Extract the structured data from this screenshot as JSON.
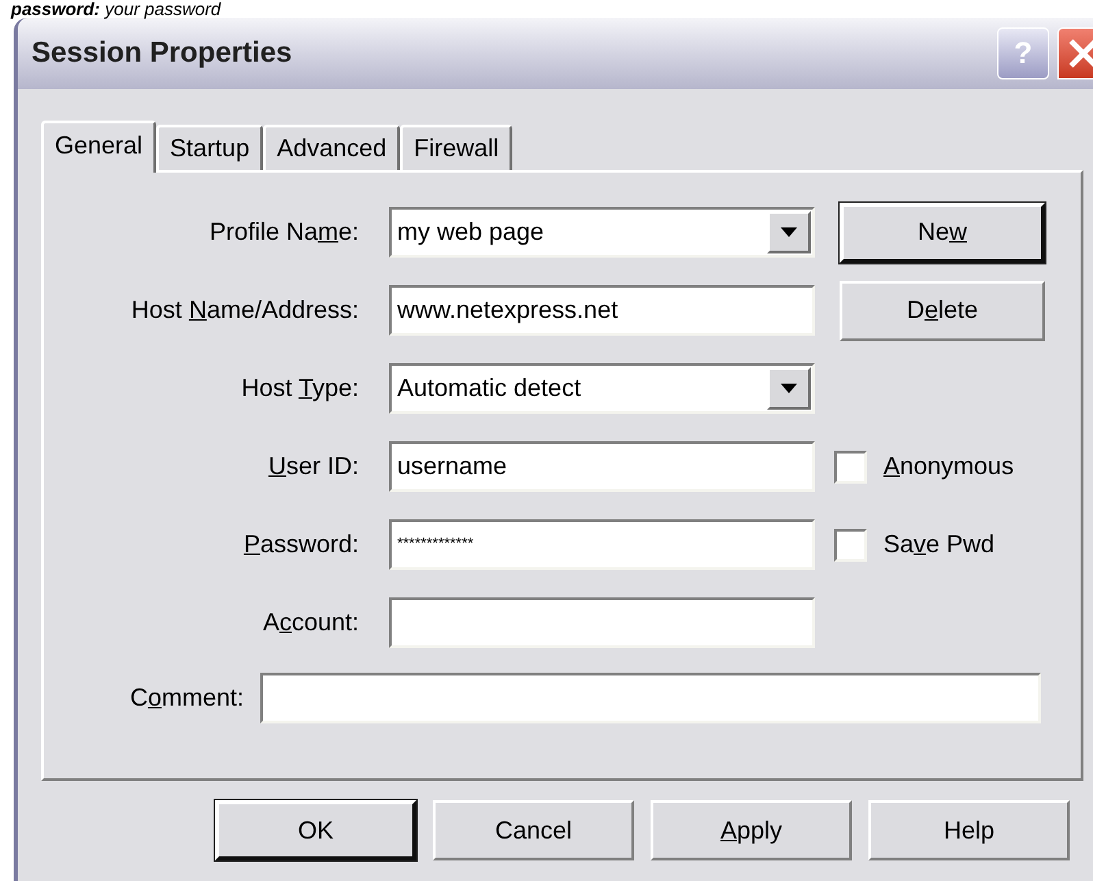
{
  "caption": "**password:** your password",
  "window": {
    "title": "Session Properties",
    "buttons": [
      {
        "kind": "help",
        "label": "?"
      },
      {
        "kind": "close"
      }
    ]
  },
  "tabs": [
    {
      "label": "General",
      "selected": true
    },
    {
      "label": "Startup",
      "selected": false
    },
    {
      "label": "Advanced",
      "selected": false
    },
    {
      "label": "Firewall",
      "selected": false
    }
  ],
  "fields": [
    {
      "kind": "combo",
      "label": {
        "pre": "Profile Na",
        "key": "m",
        "post": "e:"
      },
      "value": "my web page"
    },
    {
      "kind": "text",
      "label": {
        "pre": "Host ",
        "key": "N",
        "post": "ame/Address:"
      },
      "value": "www.netexpress.net"
    },
    {
      "kind": "combo",
      "label": {
        "pre": "Host ",
        "key": "T",
        "post": "ype:"
      },
      "value": "Automatic detect"
    },
    {
      "kind": "text",
      "label": {
        "key": "U",
        "post": "ser ID:"
      },
      "value": "username",
      "checkbox": {
        "label": {
          "key": "A",
          "post": "nonymous"
        },
        "checked": false
      }
    },
    {
      "kind": "password",
      "label": {
        "key": "P",
        "post": "assword:"
      },
      "value": "*************",
      "checkbox": {
        "label": {
          "pre": "Sa",
          "key": "v",
          "post": "e Pwd"
        },
        "checked": false
      }
    },
    {
      "kind": "text",
      "label": {
        "pre": "A",
        "key": "c",
        "post": "count:"
      }
    }
  ],
  "side_buttons": [
    {
      "label": {
        "pre": "Ne",
        "key": "w"
      },
      "default": true
    },
    {
      "label": {
        "pre": "D",
        "key": "e",
        "post": "lete"
      },
      "default": false
    }
  ],
  "comment": {
    "label": {
      "pre": "C",
      "key": "o",
      "post": "mment:"
    }
  },
  "footer_buttons": [
    {
      "label": {
        "pre": "OK"
      },
      "default": true
    },
    {
      "label": {
        "pre": "Cancel"
      },
      "default": false
    },
    {
      "label": {
        "key": "A",
        "post": "pply"
      },
      "default": false
    },
    {
      "label": {
        "pre": "Help"
      },
      "default": false
    }
  ]
}
